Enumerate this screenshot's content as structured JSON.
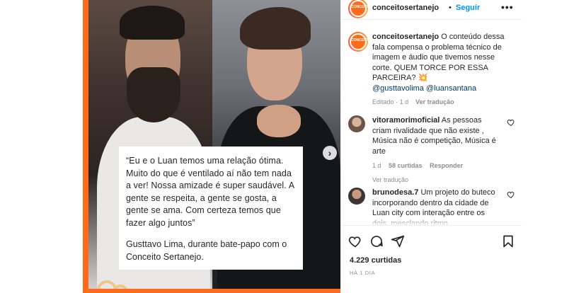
{
  "post": {
    "quote": "“Eu e o Luan temos uma relação ótima. Muito do que é ventilado aí não tem nada a ver! Nossa amizade é super saudável. A gente se respeita, a gente se gosta, a gente se ama. Com certeza temos que fazer algo juntos”",
    "author": "Gusttavo Lima, durante bate-papo com o Conceito Sertanejo.",
    "next_arrow": "›"
  },
  "header": {
    "avatar_text": "CONCEITO",
    "username": "conceitosertanejo",
    "separator": "•",
    "follow": "Seguir",
    "more": "•••"
  },
  "caption": {
    "username": "conceitosertanejo",
    "text": " O conteúdo dessa fala compensa o problema técnico de imagem e áudio que tivemos nesse corte. QUEM TORCE POR ESSA PARCEIRA? 💥",
    "mention1": "@gusttavolima",
    "mention2": "@luansantana",
    "edited": "Editado",
    "dot": "·",
    "age": "1 d",
    "translate": "Ver tradução"
  },
  "comments": [
    {
      "username": "vitoramorimoficial",
      "text": " As pessoas criam rivalidade que não existe , Música não é competição, Música é arte",
      "age": "1 d",
      "likes": "58 curtidas",
      "reply": "Responder",
      "translate": "Ver tradução"
    },
    {
      "username": "brunodesa.7",
      "text": " Um projeto do buteco incorporando dentro da cidade de Luan city com interação entre os dois, mesclando ritmo"
    }
  ],
  "footer": {
    "likes": "4.229 curtidas",
    "time": "HÁ 1 DIA"
  },
  "colors": {
    "brand_orange": "#ff6b1a",
    "link_blue": "#0095f6",
    "mention_blue": "#00376b",
    "muted": "#8e8e8e"
  },
  "icons": [
    "heart-icon",
    "comment-icon",
    "share-icon",
    "bookmark-icon",
    "more-icon",
    "chevron-right-icon"
  ]
}
